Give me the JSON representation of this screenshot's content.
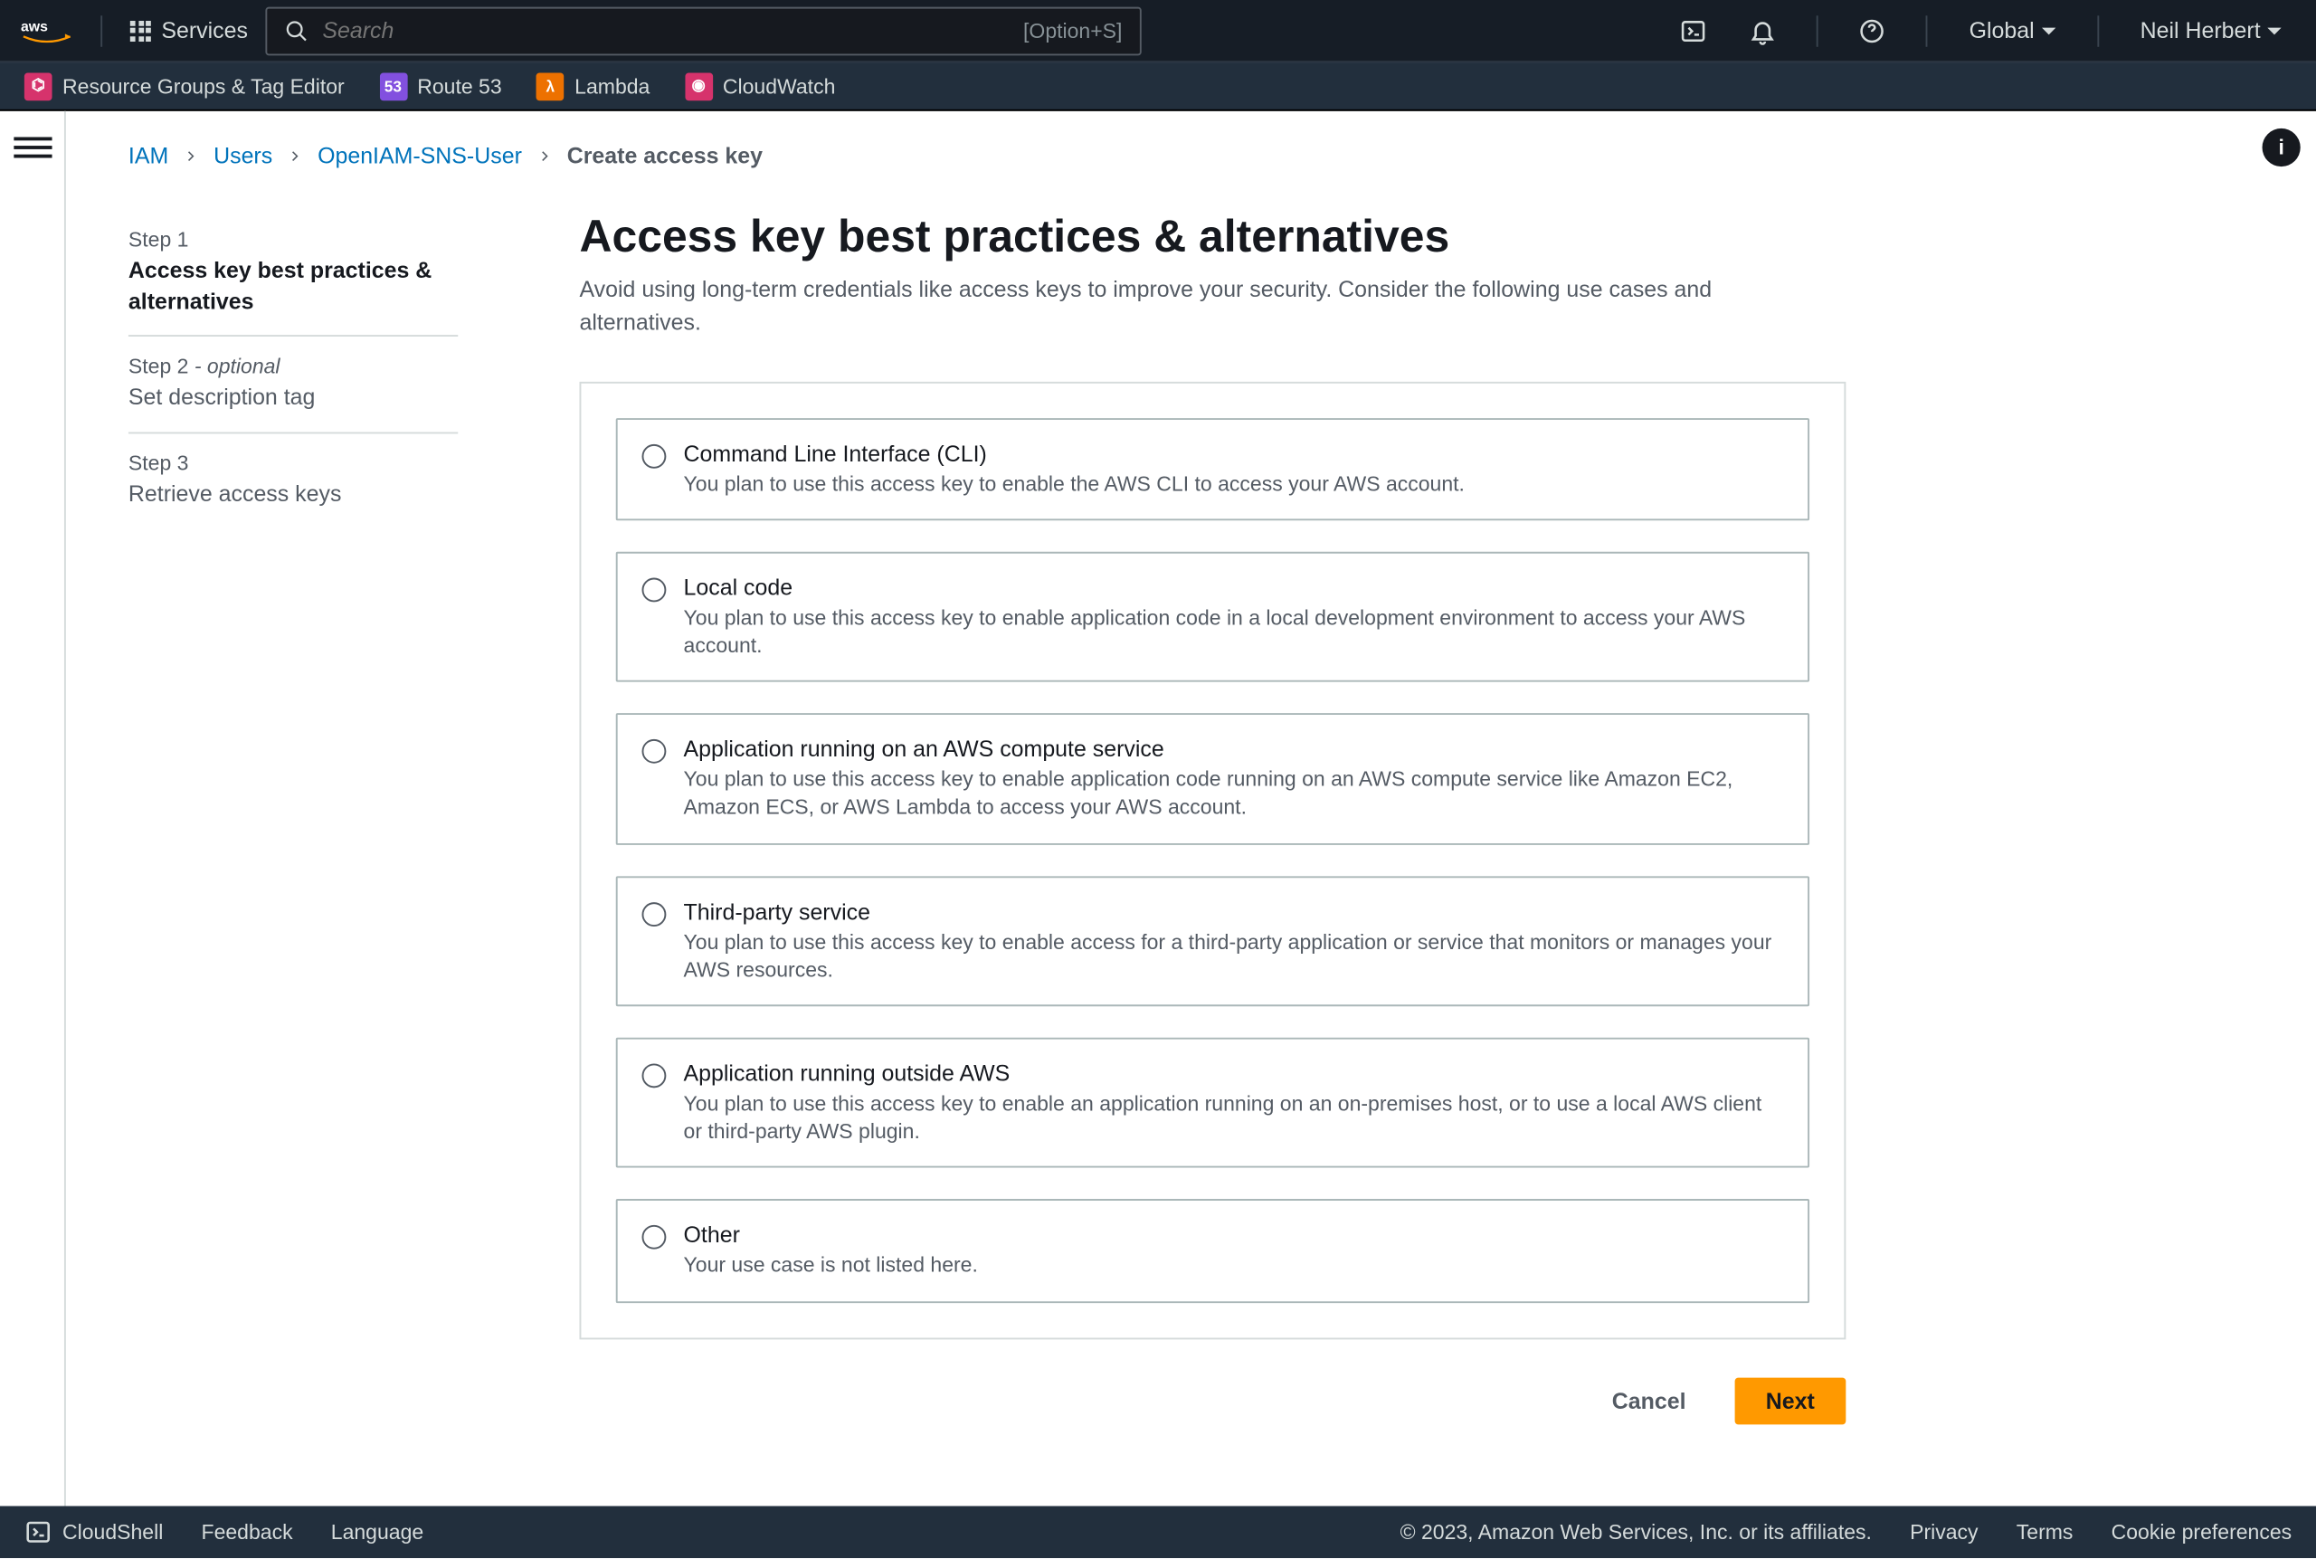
{
  "header": {
    "services_label": "Services",
    "search_placeholder": "Search",
    "search_hint": "[Option+S]",
    "region": "Global",
    "account": "Neil Herbert"
  },
  "shortcuts": [
    {
      "label": "Resource Groups & Tag Editor",
      "color": "#d6336c"
    },
    {
      "label": "Route 53",
      "color": "#8250df"
    },
    {
      "label": "Lambda",
      "color": "#ed7100"
    },
    {
      "label": "CloudWatch",
      "color": "#d6336c"
    }
  ],
  "breadcrumbs": {
    "items": [
      "IAM",
      "Users",
      "OpenIAM-SNS-User"
    ],
    "current": "Create access key"
  },
  "steps": [
    {
      "label": "Step 1",
      "optional": false,
      "title": "Access key best practices & alternatives",
      "active": true
    },
    {
      "label": "Step 2",
      "optional": true,
      "title": "Set description tag",
      "active": false
    },
    {
      "label": "Step 3",
      "optional": false,
      "title": "Retrieve access keys",
      "active": false
    }
  ],
  "page": {
    "title": "Access key best practices & alternatives",
    "subtitle": "Avoid using long-term credentials like access keys to improve your security. Consider the following use cases and alternatives."
  },
  "options": [
    {
      "title": "Command Line Interface (CLI)",
      "desc": "You plan to use this access key to enable the AWS CLI to access your AWS account."
    },
    {
      "title": "Local code",
      "desc": "You plan to use this access key to enable application code in a local development environment to access your AWS account."
    },
    {
      "title": "Application running on an AWS compute service",
      "desc": "You plan to use this access key to enable application code running on an AWS compute service like Amazon EC2, Amazon ECS, or AWS Lambda to access your AWS account."
    },
    {
      "title": "Third-party service",
      "desc": "You plan to use this access key to enable access for a third-party application or service that monitors or manages your AWS resources."
    },
    {
      "title": "Application running outside AWS",
      "desc": "You plan to use this access key to enable an application running on an on-premises host, or to use a local AWS client or third-party AWS plugin."
    },
    {
      "title": "Other",
      "desc": "Your use case is not listed here."
    }
  ],
  "actions": {
    "cancel": "Cancel",
    "next": "Next"
  },
  "footer": {
    "cloudshell": "CloudShell",
    "feedback": "Feedback",
    "language": "Language",
    "copyright": "© 2023, Amazon Web Services, Inc. or its affiliates.",
    "privacy": "Privacy",
    "terms": "Terms",
    "cookie": "Cookie preferences"
  }
}
